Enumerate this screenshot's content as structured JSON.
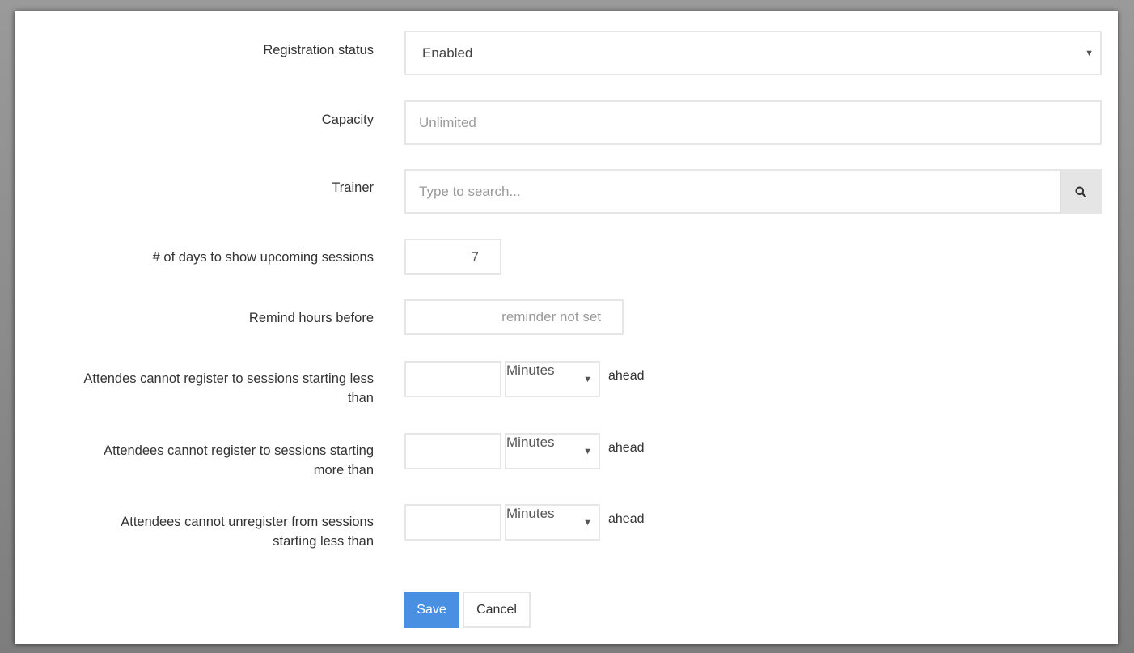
{
  "form": {
    "registration_status": {
      "label": "Registration status",
      "value": "Enabled"
    },
    "capacity": {
      "label": "Capacity",
      "placeholder": "Unlimited"
    },
    "trainer": {
      "label": "Trainer",
      "placeholder": "Type to search..."
    },
    "days_upcoming": {
      "label": "# of days to show upcoming sessions",
      "value": "7"
    },
    "remind_hours": {
      "label": "Remind hours before",
      "placeholder": "reminder not set"
    },
    "register_less_than": {
      "label_line1": "Attendes cannot register to sessions starting less",
      "label_line2": "than",
      "unit": "Minutes",
      "suffix": "ahead"
    },
    "register_more_than": {
      "label_line1": "Attendees cannot register to sessions starting",
      "label_line2": "more than",
      "unit": "Minutes",
      "suffix": "ahead"
    },
    "unregister_less_than": {
      "label_line1": "Attendees cannot unregister from sessions",
      "label_line2": "starting less than",
      "unit": "Minutes",
      "suffix": "ahead"
    }
  },
  "buttons": {
    "save": "Save",
    "cancel": "Cancel"
  },
  "icons": {
    "dropdown_caret": "▼",
    "search": "search-icon"
  },
  "colors": {
    "primary": "#4a90e2",
    "border": "#e6e6e6",
    "placeholder": "#9a9a9a"
  }
}
